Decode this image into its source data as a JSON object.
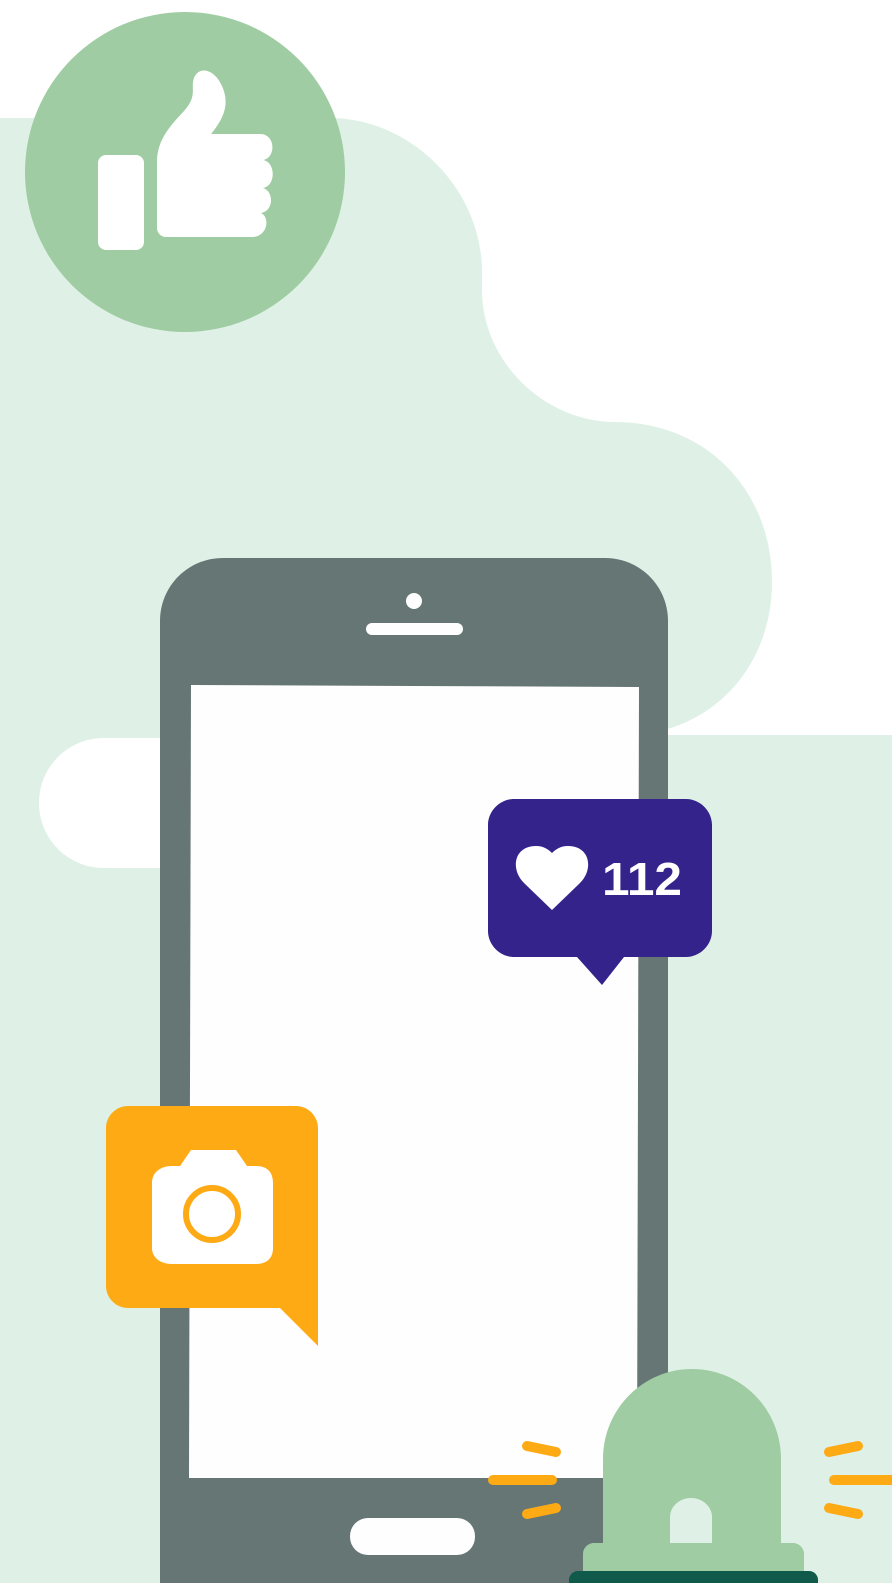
{
  "illustration": {
    "like_notification": {
      "icon": "heart-icon",
      "count": "112"
    },
    "photo_notification": {
      "icon": "camera-icon"
    },
    "thumbs_up_badge": {
      "icon": "thumbs-up-icon"
    },
    "alert_siren": {
      "icon": "siren-icon"
    },
    "colors": {
      "background_blob": "#dff1e6",
      "phone_body": "#667675",
      "phone_screen": "#fefefe",
      "thumbs_badge": "#9fcca2",
      "like_bubble": "#33238a",
      "photo_bubble": "#fdaa15",
      "siren_dome": "#9fcca2",
      "siren_base": "#0f5a4a",
      "siren_rays": "#fdaa15"
    }
  }
}
